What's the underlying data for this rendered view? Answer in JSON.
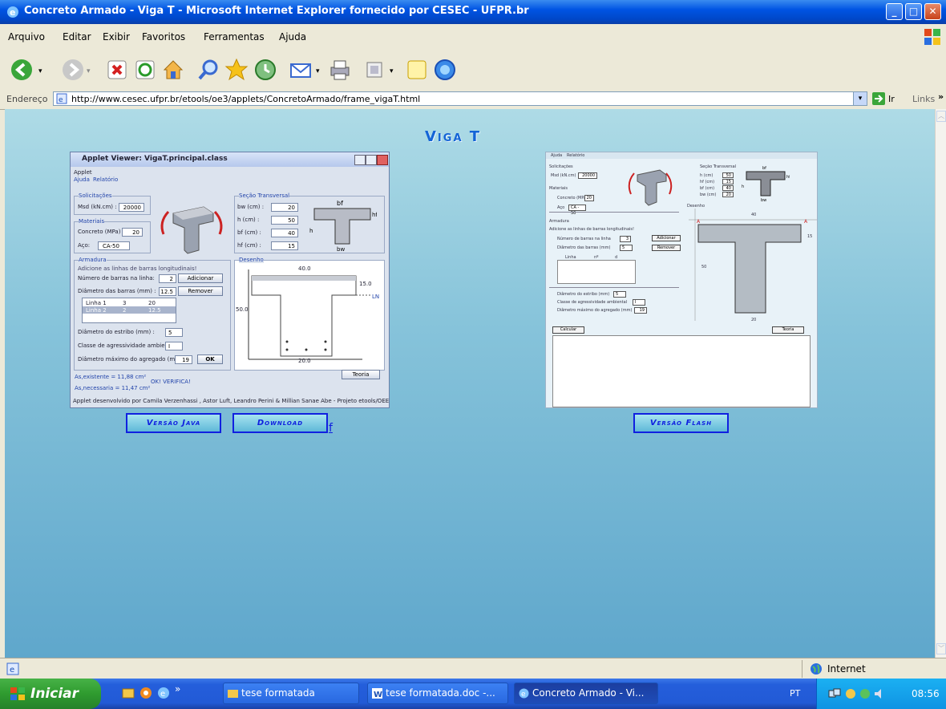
{
  "window": {
    "title": "Concreto Armado - Viga T - Microsoft Internet Explorer fornecido por CESEC - UFPR.br"
  },
  "menu": [
    "Arquivo",
    "Editar",
    "Exibir",
    "Favoritos",
    "Ferramentas",
    "Ajuda"
  ],
  "address": {
    "label": "Endereço",
    "url": "http://www.cesec.ufpr.br/etools/oe3/applets/ConcretoArmado/frame_vigaT.html",
    "go": "Ir",
    "links": "Links"
  },
  "page": {
    "heading": "Viga T"
  },
  "applet": {
    "title": "Applet Viewer: VigaT.principal.class",
    "menu_applet": "Applet",
    "menu_ajuda": "Ajuda",
    "menu_relatorio": "Relatório",
    "solicitacoes": "Solicitações",
    "msd_label": "Msd (kN.cm) :",
    "msd_value": "20000",
    "materiais": "Materiais",
    "concreto_label": "Concreto (MPa) :",
    "concreto_value": "20",
    "aco_label": "Aço:",
    "aco_value": "CA-50",
    "secao": "Seção Transversal",
    "bw_label": "bw (cm) :",
    "bw_value": "20",
    "h_label": "h (cm) :",
    "h_value": "50",
    "bf_label": "bf (cm) :",
    "bf_value": "40",
    "hf_label": "hf (cm) :",
    "hf_value": "15",
    "armadura": "Armadura",
    "armadura_hint": "Adicione as linhas de barras longitudinais!",
    "num_barras_label": "Número de barras na linha:",
    "num_barras_value": "2",
    "adicionar": "Adicionar",
    "diam_barras_label": "Diâmetro das barras (mm) :",
    "diam_barras_value": "12.5",
    "remover": "Remover",
    "linhas": [
      [
        "Linha 1",
        "3",
        "20"
      ],
      [
        "Linha 2",
        "2",
        "12.5"
      ]
    ],
    "estribo_label": "Diâmetro do estribo (mm) :",
    "estribo_value": "5",
    "agressividade_label": "Classe de agressividade ambiental:",
    "agressividade_value": "I",
    "agregado_label": "Diâmetro máximo do agregado (mm):",
    "agregado_value": "19",
    "ok": "OK",
    "desenho": "Desenho",
    "dim_bf": "40.0",
    "dim_hf": "15.0",
    "dim_ln": "LN",
    "dim_h": "50.0",
    "dim_bw": "20.0",
    "teoria": "Teoria",
    "as_existente": "As,existente  = 11,88 cm²",
    "verificacao": "OK! VERIFICA!",
    "as_necessaria": "As,necessaria = 11,47 cm²",
    "footer": "Applet desenvolvido por Camila Verzenhassi , Astor Luft, Leandro Perini & Millian Sanae Abe - Projeto etools/OEEE - C"
  },
  "flash": {
    "menu_ajuda": "Ajuda",
    "menu_relatorio": "Relatório",
    "solicitacoes": "Solicitações",
    "msd_label": "Msd (kN.cm)",
    "msd_value": "20000",
    "materiais": "Materiais",
    "concreto_label": "Concreto (MPa)",
    "concreto_value": "20",
    "aco_label": "Aço",
    "aco_value": "CA - 50",
    "secao": "Seção Transversal",
    "h_label": "h (cm)",
    "h_value": "50",
    "hf_label": "hf (cm)",
    "hf_value": "15",
    "bf_label": "bf (cm)",
    "bf_value": "40",
    "bw_label": "bw (cm)",
    "bw_value": "20",
    "desenho": "Desenho",
    "armadura": "Armadura",
    "armadura_hint": "Adicione as linhas de barras longitudinais!",
    "num_barras_label": "Número de barras na linha",
    "num_barras_value": "3",
    "diam_barras_label": "Diâmetro das barras (mm)",
    "diam_barras_value": "5",
    "adicionar": "Adicionar",
    "remover": "Remover",
    "col_linha": "Linha",
    "col_n": "nº",
    "col_d": "d",
    "estribo_label": "Diâmetro do estribo (mm)",
    "estribo_value": "5",
    "agressividade_label": "Classe de agressividade ambiental",
    "agressividade_value": "I",
    "agregado_label": "Diâmetro máximo do agregado (mm)",
    "agregado_value": "19",
    "dim_top": "40",
    "dim_hf": "15",
    "dim_h": "50",
    "dim_bw": "20",
    "calcular": "Calcular",
    "teoria": "Teoria"
  },
  "buttons": {
    "java": "Versão Java",
    "download": "Download",
    "flash": "Versão Flash",
    "trailing": "f"
  },
  "status": {
    "zone": "Internet"
  },
  "taskbar": {
    "start": "Iniciar",
    "tasks": [
      "tese formatada",
      "tese formatada.doc -...",
      "Concreto Armado - Vi..."
    ],
    "lang": "PT",
    "time": "08:56"
  }
}
